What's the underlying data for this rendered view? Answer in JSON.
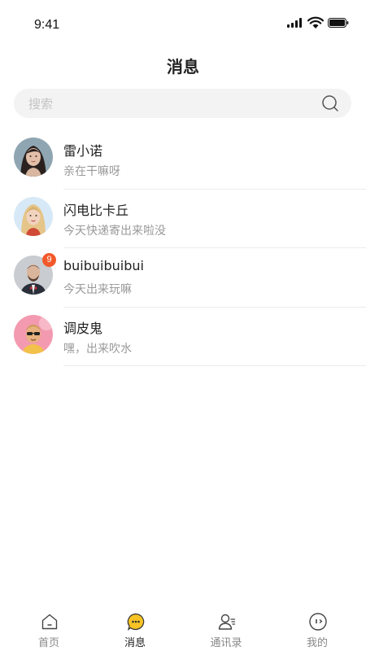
{
  "status_bar": {
    "time": "9:41"
  },
  "header": {
    "title": "消息"
  },
  "search": {
    "placeholder": "搜索",
    "value": ""
  },
  "chats": [
    {
      "name": "雷小诺",
      "message": "亲在干嘛呀",
      "avatar": "avatar-woman-dark-hair",
      "badge": ""
    },
    {
      "name": "闪电比卡丘",
      "message": "今天快递寄出来啦没",
      "avatar": "avatar-woman-blonde",
      "badge": ""
    },
    {
      "name": "buibuibuibui",
      "message": "今天出来玩嘛",
      "avatar": "avatar-man-bowtie",
      "badge": "9"
    },
    {
      "name": "调皮鬼",
      "message": "嘿，出来吹水",
      "avatar": "avatar-man-sunglasses",
      "badge": ""
    }
  ],
  "tab_bar": {
    "items": [
      {
        "label": "首页",
        "icon": "home-icon",
        "active": false
      },
      {
        "label": "消息",
        "icon": "message-icon",
        "active": true
      },
      {
        "label": "通讯录",
        "icon": "contacts-icon",
        "active": false
      },
      {
        "label": "我的",
        "icon": "profile-icon",
        "active": false
      }
    ]
  },
  "colors": {
    "accent": "#f7c325",
    "badge": "#f2582a",
    "muted_text": "#999999",
    "search_bg": "#f3f3f3"
  }
}
